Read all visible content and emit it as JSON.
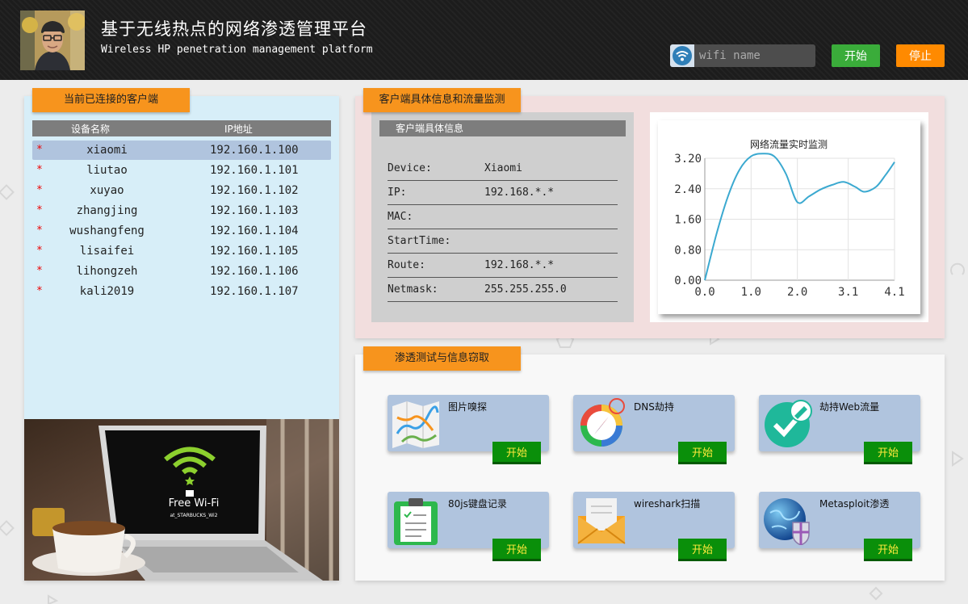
{
  "header": {
    "title": "基于无线热点的网络渗透管理平台",
    "subtitle": "Wireless HP penetration management platform",
    "wifi_placeholder": "wifi name",
    "start_label": "开始",
    "stop_label": "停止"
  },
  "clients": {
    "tab_label": "当前已连接的客户端",
    "col_name": "设备名称",
    "col_ip": "IP地址",
    "star": "*",
    "rows": [
      {
        "name": "xiaomi",
        "ip": "192.160.1.100"
      },
      {
        "name": "liutao",
        "ip": "192.160.1.101"
      },
      {
        "name": "xuyao",
        "ip": "192.160.1.102"
      },
      {
        "name": "zhangjing",
        "ip": "192.160.1.103"
      },
      {
        "name": "wushangfeng",
        "ip": "192.160.1.104"
      },
      {
        "name": "lisaifei",
        "ip": "192.160.1.105"
      },
      {
        "name": "lihongzeh",
        "ip": "192.160.1.106"
      },
      {
        "name": "kali2019",
        "ip": "192.160.1.107"
      }
    ],
    "photo": {
      "screen_text": "Free Wi-Fi",
      "screen_subtext": "at_STARBUCKS_Wi2"
    }
  },
  "monitor": {
    "tab_label": "客户端具体信息和流量监测",
    "detail_header": "客户端具体信息",
    "details": [
      {
        "key": "Device:",
        "value": "Xiaomi"
      },
      {
        "key": "IP:",
        "value": "192.168.*.*"
      },
      {
        "key": "MAC:",
        "value": ""
      },
      {
        "key": "StartTime:",
        "value": ""
      },
      {
        "key": "Route:",
        "value": "192.168.*.*"
      },
      {
        "key": "Netmask:",
        "value": "255.255.255.0"
      }
    ]
  },
  "chart_data": {
    "type": "line",
    "title": "网络流量实时监测",
    "xlabel": "",
    "ylabel": "",
    "x_ticks": [
      "0.0",
      "1.0",
      "2.0",
      "3.1",
      "4.1"
    ],
    "y_ticks": [
      "0.00",
      "0.80",
      "1.60",
      "2.40",
      "3.20"
    ],
    "xlim": [
      0,
      4.1
    ],
    "ylim": [
      0,
      3.2
    ],
    "grid": true,
    "line_color": "#3ba9d0",
    "series": [
      {
        "x": [
          0.0,
          0.25,
          0.5,
          0.75,
          1.0,
          1.25,
          1.5,
          1.75,
          2.0,
          2.25,
          2.5,
          2.75,
          3.0,
          3.25,
          3.45,
          3.7,
          3.9,
          4.1
        ],
        "values": [
          0.0,
          1.2,
          2.2,
          2.9,
          3.25,
          3.35,
          3.25,
          2.8,
          2.05,
          2.2,
          2.38,
          2.5,
          2.58,
          2.45,
          2.32,
          2.45,
          2.75,
          3.1
        ]
      }
    ]
  },
  "pentest": {
    "tab_label": "渗透测试与信息窃取",
    "tools": [
      {
        "name": "图片嗅探",
        "button": "开始",
        "icon": "map-icon"
      },
      {
        "name": "DNS劫持",
        "button": "开始",
        "icon": "compass-icon"
      },
      {
        "name": "劫持Web流量",
        "button": "开始",
        "icon": "edit-check-icon"
      },
      {
        "name": "80js键盘记录",
        "button": "开始",
        "icon": "clipboard-icon"
      },
      {
        "name": "wireshark扫描",
        "button": "开始",
        "icon": "envelope-icon"
      },
      {
        "name": "Metasploit渗透",
        "button": "开始",
        "icon": "globe-shield-icon"
      }
    ]
  },
  "colors": {
    "accent_orange": "#f7941d",
    "start_green": "#3aac3a",
    "stop_orange": "#ff8a00",
    "tool_button_green": "#0a8f0a",
    "tool_button_text": "#ffe93c"
  }
}
